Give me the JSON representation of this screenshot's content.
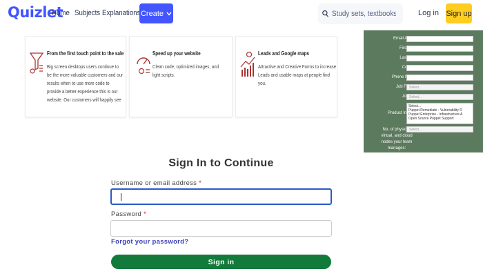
{
  "nav": {
    "logo": "Quizlet",
    "links": [
      "Home",
      "Subjects",
      "Explanations"
    ],
    "create_label": "Create",
    "search_placeholder": "Study sets, textbooks, ...",
    "login_label": "Log in",
    "signup_label": "Sign up",
    "accent_color": "#4255ff",
    "signup_color": "#ffcd1f"
  },
  "cards": [
    {
      "title": "From the first touch point to the sale",
      "body": "Big screen desktops users continue to be the more valuable customers and our results when to use more code to provide a better experience this is our website. Our customers will happily see itCustomers browse the website or see ads several times before they buy a product or hire your company. Let's help them in the user journey.",
      "icon": "sales-funnel-icon"
    },
    {
      "title": "Speed up your website",
      "body": "Clean code, optimized images, and light scripts.",
      "icon": "speedometer-icon"
    },
    {
      "title": "Leads and Google maps",
      "body": "Attractive and Creative Forms to increase Leads and usable maps at people find you.",
      "icon": "growth-chart-icon"
    }
  ],
  "side_form": {
    "labels": [
      "Email Address:",
      "First Name:",
      "Last Name:",
      "Company:",
      "Phone Number:",
      "Job Function:",
      "Job Level:"
    ],
    "select_placeholder": "Select...",
    "product_label": "Product Interest:",
    "product_options": [
      "Select...",
      "Puppet Remediate - Vulnerability R",
      "Puppet Enterprise - Infrastructure A",
      "Open Source Puppet Support"
    ],
    "nodes_label": "No. of physical, virtual, and cloud nodes your team manages:",
    "panel_color": "#5c7a5e"
  },
  "signin": {
    "title": "Sign In to Continue",
    "username_label": "Username or email address",
    "password_label": "Password",
    "required_mark": "*",
    "forgot_label": "Forgot your password?",
    "submit_label": "Sign in",
    "button_color": "#127a3a"
  }
}
